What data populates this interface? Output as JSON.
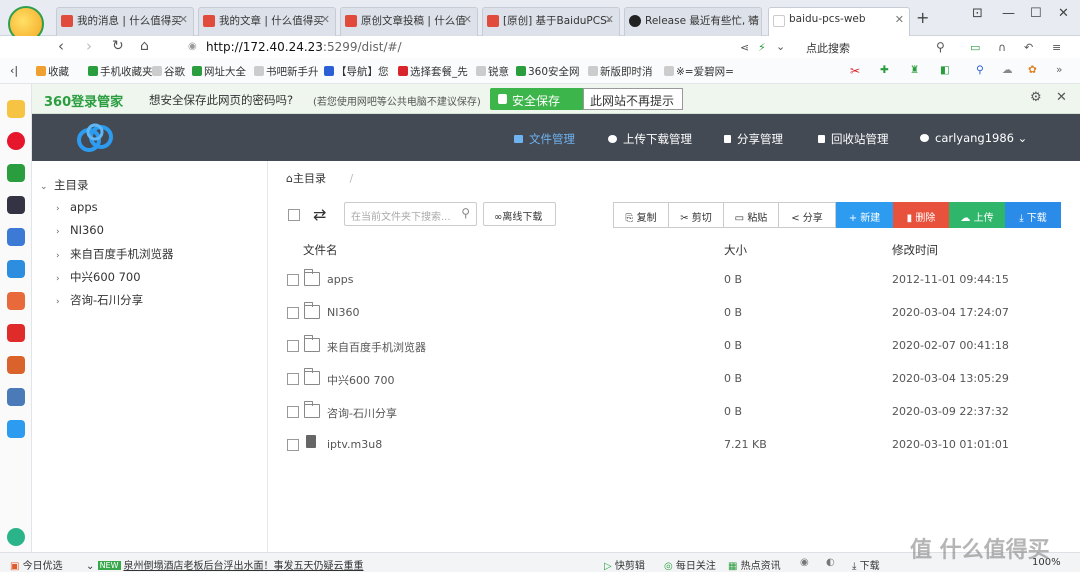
{
  "browser": {
    "tabs": [
      {
        "title": "我的消息 | 什么值得买"
      },
      {
        "title": "我的文章 | 什么值得买"
      },
      {
        "title": "原创文章投稿 | 什么值"
      },
      {
        "title": "[原创] 基于BaiduPCS-"
      },
      {
        "title": "Release 最近有些忙, 请"
      },
      {
        "title": "baidu-pcs-web"
      }
    ],
    "new_tab_label": "+",
    "window_controls": {
      "tray": "⊡",
      "minimize": "—",
      "maximize": "☐",
      "close": "✕"
    },
    "url_host": "http://172.40.24.23",
    "url_path": ":5299/dist/#/",
    "search_placeholder": "点此搜索",
    "zoom_label": "100%"
  },
  "bookmarks": [
    "收藏",
    "手机收藏夹",
    "谷歌",
    "网址大全",
    "书吧新手升",
    "【导航】您",
    "选择套餐_先",
    "锐意",
    "360安全网",
    "新版即时消",
    "※=爱碧网="
  ],
  "password_bar": {
    "brand": "360登录管家",
    "prompt": "想安全保存此网页的密码吗?",
    "note": "(若您使用网吧等公共电脑不建议保存)",
    "save_label": "安全保存",
    "never_label": "此网站不再提示"
  },
  "app": {
    "nav": [
      {
        "label": "文件管理",
        "active": true
      },
      {
        "label": "上传下载管理",
        "active": false
      },
      {
        "label": "分享管理",
        "active": false
      },
      {
        "label": "回收站管理",
        "active": false
      },
      {
        "label": "carlyang1986",
        "active": false
      }
    ],
    "user_caret": "⌄",
    "tree_root": "主目录",
    "tree_items": [
      "apps",
      "NI360",
      "来自百度手机浏览器",
      "中兴600 700",
      "咨询-石川分享"
    ],
    "breadcrumb": "主目录",
    "breadcrumb_sep": "/",
    "search_placeholder": "在当前文件夹下搜索...",
    "offline_download": "∞离线下载",
    "toolbar": {
      "copy": "复制",
      "cut": "剪切",
      "paste": "粘贴",
      "share": "分享",
      "new": "+ 新建",
      "delete": "删除",
      "upload": "上传",
      "download": "下载"
    },
    "columns": {
      "name": "文件名",
      "size": "大小",
      "mtime": "修改时间"
    },
    "files": [
      {
        "name": "apps",
        "size": "0 B",
        "mtime": "2012-11-01 09:44:15",
        "type": "folder"
      },
      {
        "name": "NI360",
        "size": "0 B",
        "mtime": "2020-03-04 17:24:07",
        "type": "folder"
      },
      {
        "name": "来自百度手机浏览器",
        "size": "0 B",
        "mtime": "2020-02-07 00:41:18",
        "type": "folder"
      },
      {
        "name": "中兴600 700",
        "size": "0 B",
        "mtime": "2020-03-04 13:05:29",
        "type": "folder"
      },
      {
        "name": "咨询-石川分享",
        "size": "0 B",
        "mtime": "2020-03-09 22:37:32",
        "type": "folder"
      },
      {
        "name": "iptv.m3u8",
        "size": "7.21 KB",
        "mtime": "2020-03-10 01:01:01",
        "type": "file"
      }
    ]
  },
  "statusbar": {
    "today": "今日优选",
    "news_tag": "NEW",
    "news": "泉州倒塌酒店老板后台浮出水面！事发五天仍疑云重重",
    "items": [
      "快剪辑",
      "每日关注",
      "热点资讯",
      "下载"
    ]
  },
  "watermark": "值 什么值得买",
  "colors": {
    "topnav": "#434a54",
    "accent": "#2d9cf0",
    "danger": "#e8513b",
    "success": "#2fb66a"
  }
}
